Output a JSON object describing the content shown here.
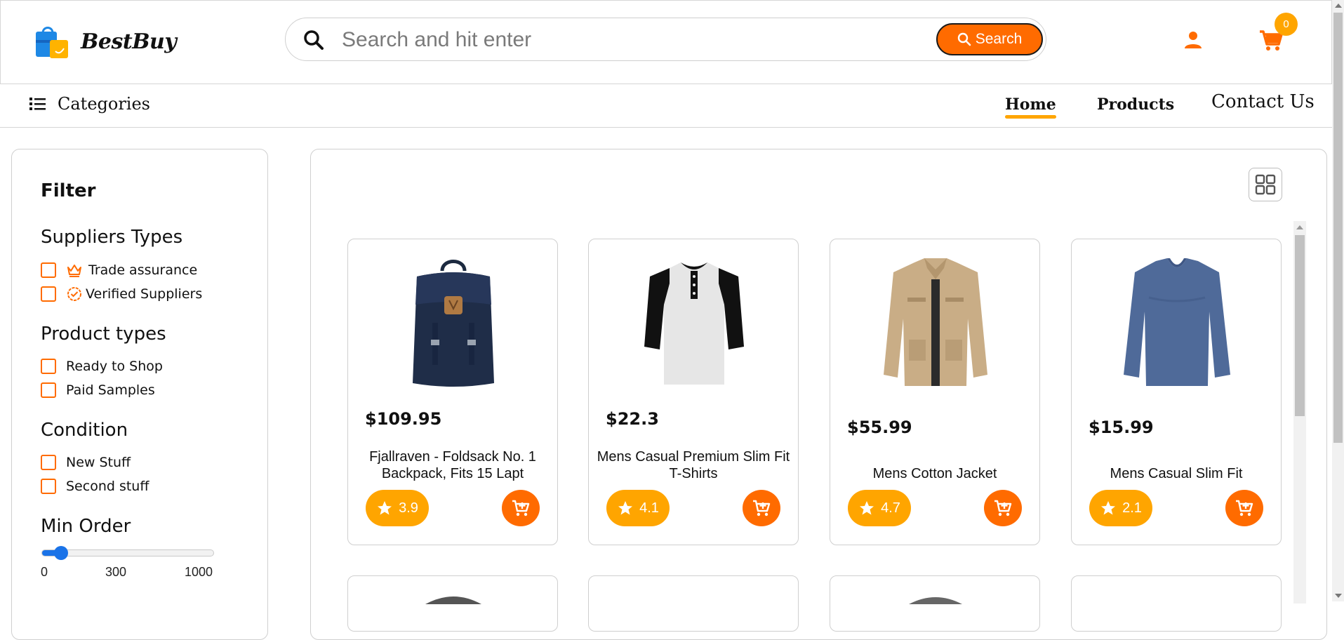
{
  "brand": {
    "name": "BestBuy",
    "logo_icon": "shopping-bag-icon"
  },
  "search": {
    "placeholder": "Search and hit enter",
    "value": "",
    "button_label": "Search"
  },
  "header": {
    "cart_count": "0"
  },
  "nav": {
    "categories_label": "Categories",
    "links": [
      {
        "label": "Home",
        "active": true
      },
      {
        "label": "Products",
        "active": false
      },
      {
        "label": "Contact Us",
        "active": false
      }
    ]
  },
  "filter": {
    "title": "Filter",
    "suppliers": {
      "title": "Suppliers Types",
      "options": [
        {
          "label": "Trade assurance",
          "icon": "crown-icon",
          "checked": false
        },
        {
          "label": "Verified Suppliers",
          "icon": "verified-badge-icon",
          "checked": false
        }
      ]
    },
    "product_types": {
      "title": "Product types",
      "options": [
        {
          "label": "Ready to Shop",
          "checked": false
        },
        {
          "label": "Paid Samples",
          "checked": false
        }
      ]
    },
    "condition": {
      "title": "Condition",
      "options": [
        {
          "label": "New Stuff",
          "checked": false
        },
        {
          "label": "Second stuff",
          "checked": false
        }
      ]
    },
    "min_order": {
      "title": "Min Order",
      "ticks": [
        "0",
        "300",
        "1000"
      ],
      "value_fraction": 0.07
    }
  },
  "products": [
    {
      "price": "$109.95",
      "name": "Fjallraven - Foldsack No. 1 Backpack, Fits 15 Lapt",
      "rating": "3.9",
      "image": "backpack"
    },
    {
      "price": "$22.3",
      "name": "Mens Casual Premium Slim Fit T-Shirts",
      "rating": "4.1",
      "image": "henley-shirt"
    },
    {
      "price": "$55.99",
      "name": "Mens Cotton Jacket",
      "rating": "4.7",
      "image": "cotton-jacket"
    },
    {
      "price": "$15.99",
      "name": "Mens Casual Slim Fit",
      "rating": "2.1",
      "image": "long-sleeve-tee"
    }
  ],
  "colors": {
    "accent": "#ff6b00",
    "rating": "#ffa500",
    "slider": "#1a73e8"
  }
}
